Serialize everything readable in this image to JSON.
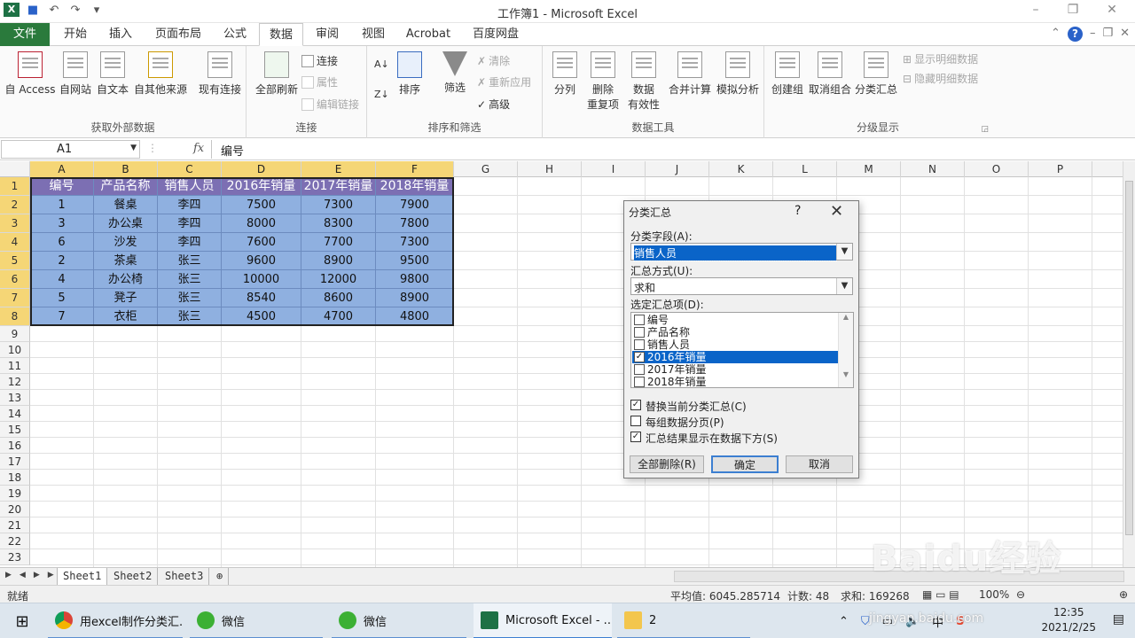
{
  "window": {
    "title": "工作簿1 - Microsoft Excel",
    "qa_undo": "↶",
    "qa_redo": "↷",
    "qa_more": "▾",
    "min": "–",
    "restore": "❐",
    "close": "✕"
  },
  "tabs": [
    "文件",
    "开始",
    "插入",
    "页面布局",
    "公式",
    "数据",
    "审阅",
    "视图",
    "Acrobat",
    "百度网盘"
  ],
  "ribbon": {
    "external": {
      "label": "获取外部数据",
      "access": "自 Access",
      "web": "自网站",
      "text": "自文本",
      "other": "自其他来源",
      "existing": "现有连接"
    },
    "connections": {
      "label": "连接",
      "refresh_all": "全部刷新",
      "connect": "连接",
      "properties": "属性",
      "edit_links": "编辑链接"
    },
    "sort_filter": {
      "label": "排序和筛选",
      "sort": "排序",
      "filter": "筛选",
      "clear": "清除",
      "reapply": "重新应用",
      "advanced": "高级"
    },
    "data_tools": {
      "label": "数据工具",
      "split": "分列",
      "remove_dup_1": "删除",
      "remove_dup_2": "重复项",
      "validation_1": "数据",
      "validation_2": "有效性",
      "consolidate": "合并计算",
      "whatif": "模拟分析"
    },
    "outline": {
      "label": "分级显示",
      "group": "创建组",
      "ungroup": "取消组合",
      "subtotal": "分类汇总",
      "show_detail": "显示明细数据",
      "hide_detail": "隐藏明细数据"
    }
  },
  "formula_bar": {
    "name_box": "A1",
    "fx": "fx",
    "value": "编号"
  },
  "columns": [
    "A",
    "B",
    "C",
    "D",
    "E",
    "F",
    "G",
    "H",
    "I",
    "J",
    "K",
    "L",
    "M",
    "N",
    "O",
    "P"
  ],
  "rows": [
    "1",
    "2",
    "3",
    "4",
    "5",
    "6",
    "7",
    "8",
    "9",
    "10",
    "11",
    "12",
    "13",
    "14",
    "15",
    "16",
    "17",
    "18",
    "19",
    "20",
    "21",
    "22",
    "23"
  ],
  "table": {
    "headers": [
      "编号",
      "产品名称",
      "销售人员",
      "2016年销量",
      "2017年销量",
      "2018年销量"
    ],
    "rows": [
      [
        "1",
        "餐桌",
        "李四",
        "7500",
        "7300",
        "7900"
      ],
      [
        "3",
        "办公桌",
        "李四",
        "8000",
        "8300",
        "7800"
      ],
      [
        "6",
        "沙发",
        "李四",
        "7600",
        "7700",
        "7300"
      ],
      [
        "2",
        "茶桌",
        "张三",
        "9600",
        "8900",
        "9500"
      ],
      [
        "4",
        "办公椅",
        "张三",
        "10000",
        "12000",
        "9800"
      ],
      [
        "5",
        "凳子",
        "张三",
        "8540",
        "8600",
        "8900"
      ],
      [
        "7",
        "衣柜",
        "张三",
        "4500",
        "4700",
        "4800"
      ]
    ]
  },
  "sheets": [
    "Sheet1",
    "Sheet2",
    "Sheet3"
  ],
  "status": {
    "ready": "就绪",
    "average": "平均值: 6045.285714",
    "count": "计数: 48",
    "sum": "求和: 169268",
    "zoom": "100%"
  },
  "dialog": {
    "title": "分类汇总",
    "help": "?",
    "close": "✕",
    "field_label": "分类字段(A):",
    "field_value": "销售人员",
    "method_label": "汇总方式(U):",
    "method_value": "求和",
    "items_label": "选定汇总项(D):",
    "items": [
      {
        "label": "编号",
        "checked": false
      },
      {
        "label": "产品名称",
        "checked": false
      },
      {
        "label": "销售人员",
        "checked": false
      },
      {
        "label": "2016年销量",
        "checked": true
      },
      {
        "label": "2017年销量",
        "checked": false
      },
      {
        "label": "2018年销量",
        "checked": false
      }
    ],
    "opt_replace": "替换当前分类汇总(C)",
    "opt_pagebreak": "每组数据分页(P)",
    "opt_below": "汇总结果显示在数据下方(S)",
    "btn_remove": "全部删除(R)",
    "btn_ok": "确定",
    "btn_cancel": "取消"
  },
  "taskbar": {
    "chrome": "用excel制作分类汇...",
    "wechat1": "微信",
    "wechat2": "微信",
    "excel": "Microsoft Excel - ...",
    "folder": "2",
    "ime": "中",
    "time": "12:35",
    "date": "2021/2/25"
  },
  "watermark": {
    "brand": "Baidu经验",
    "url": "jingyan.baidu.com"
  },
  "colors": {
    "header_fill": "#7c6fb3",
    "body_fill": "#8fb0e0",
    "file_tab": "#2a7a3c",
    "accent": "#0a64c8"
  }
}
